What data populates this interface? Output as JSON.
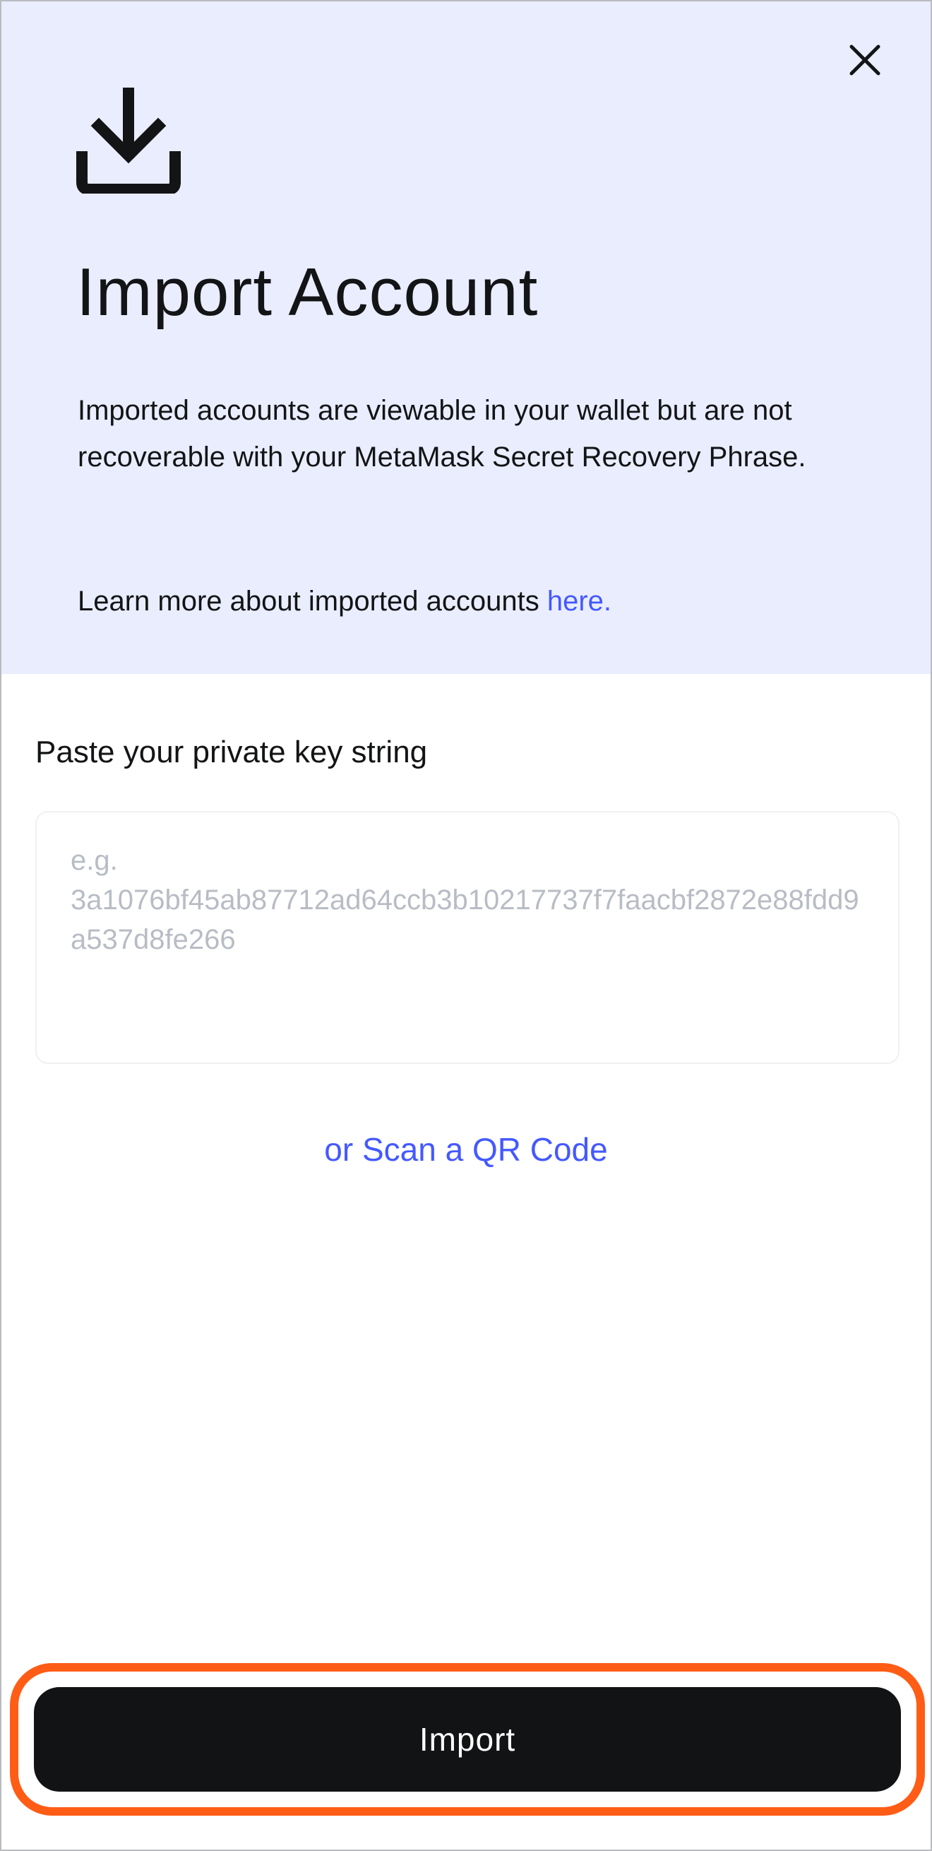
{
  "header": {
    "title": "Import Account",
    "description": "Imported accounts are viewable in your wallet but are not recoverable with your MetaMask Secret Recovery Phrase.",
    "learn_more_prefix": "Learn more about imported accounts ",
    "learn_more_link": "here.",
    "icons": {
      "close": "close-icon",
      "download": "download-icon"
    }
  },
  "form": {
    "label": "Paste your private key string",
    "value": "",
    "placeholder": "e.g.\n3a1076bf45ab87712ad64ccb3b10217737f7faacbf2872e88fdd9a537d8fe266",
    "scan_link": "or Scan a QR Code"
  },
  "footer": {
    "import_label": "Import"
  },
  "colors": {
    "header_bg": "#eaedfe",
    "link": "#4459ff",
    "button_bg": "#121314",
    "highlight": "#ff5c16",
    "placeholder": "#b8bcc4"
  }
}
